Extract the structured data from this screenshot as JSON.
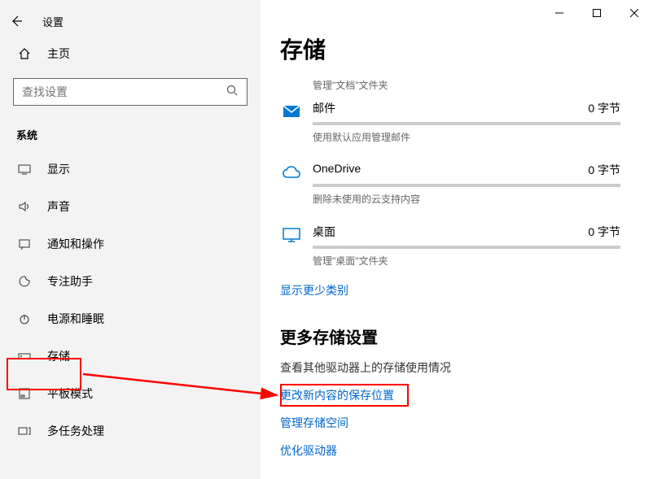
{
  "window": {
    "title": "设置"
  },
  "sidebar": {
    "home": "主页",
    "search_placeholder": "查找设置",
    "section": "系统",
    "items": [
      {
        "icon": "display",
        "label": "显示"
      },
      {
        "icon": "sound",
        "label": "声音"
      },
      {
        "icon": "notifications",
        "label": "通知和操作"
      },
      {
        "icon": "focus",
        "label": "专注助手"
      },
      {
        "icon": "power",
        "label": "电源和睡眠"
      },
      {
        "icon": "storage",
        "label": "存储"
      },
      {
        "icon": "tablet",
        "label": "平板模式"
      },
      {
        "icon": "multitask",
        "label": "多任务处理"
      }
    ]
  },
  "main": {
    "title": "存储",
    "categories": [
      {
        "icon": "",
        "name": "",
        "size": "",
        "desc": "管理\"文档\"文件夹",
        "desc_only": true
      },
      {
        "icon": "mail",
        "name": "邮件",
        "size": "0 字节",
        "desc": "使用默认应用管理邮件"
      },
      {
        "icon": "cloud",
        "name": "OneDrive",
        "size": "0 字节",
        "desc": "删除未使用的云支持内容"
      },
      {
        "icon": "desktop",
        "name": "桌面",
        "size": "0 字节",
        "desc": "管理\"桌面\"文件夹"
      }
    ],
    "show_more": "显示更少类别",
    "more_section_title": "更多存储设置",
    "more_section_desc": "查看其他驱动器上的存储使用情况",
    "links": [
      "更改新内容的保存位置",
      "管理存储空间",
      "优化驱动器"
    ]
  }
}
